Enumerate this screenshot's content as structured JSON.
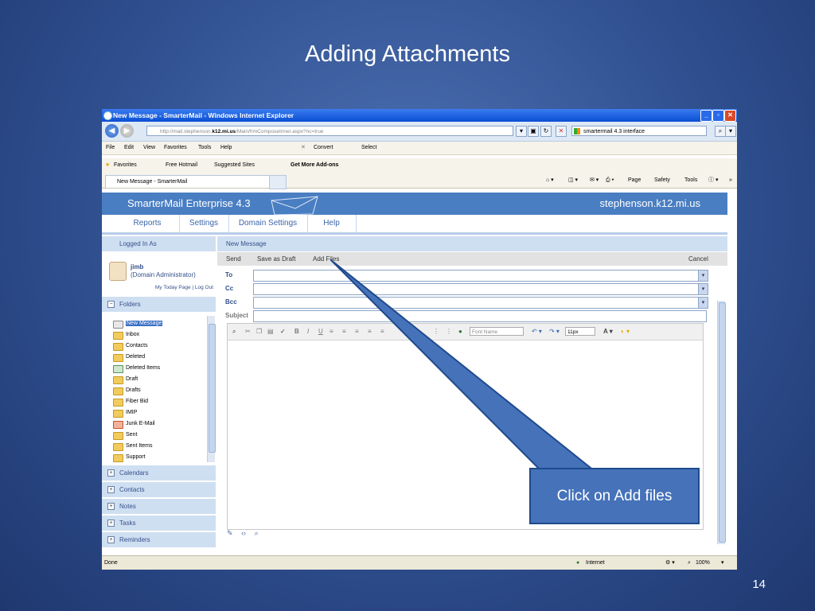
{
  "slide": {
    "title": "Adding Attachments",
    "page_number": "14"
  },
  "window": {
    "title": "New Message - SmarterMail - Windows Internet Explorer"
  },
  "address": {
    "url_prefix": "http://mail.stephenson.",
    "url_bold": "k12.mi.us",
    "url_suffix": "/Main/frmComposeInner.aspx?nc=true",
    "search_text": "smartermail 4.3 interface"
  },
  "menu": {
    "items": [
      "File",
      "Edit",
      "View",
      "Favorites",
      "Tools",
      "Help"
    ],
    "convert": "Convert",
    "select": "Select"
  },
  "favorites": {
    "label": "Favorites",
    "items": [
      "Free Hotmail",
      "Suggested Sites",
      "Get More Add-ons"
    ]
  },
  "tab": {
    "label": "New Message - SmarterMail",
    "cmd": [
      "Page",
      "Safety",
      "Tools"
    ]
  },
  "smartermail": {
    "brand": "SmarterMail Enterprise 4.3",
    "domain": "stephenson.k12.mi.us",
    "nav": [
      "Reports",
      "Settings",
      "Domain Settings",
      "Help"
    ]
  },
  "left": {
    "logged_in_header": "Logged In As",
    "user": "jimb",
    "role": "(Domain Administrator)",
    "links": "My Today Page | Log Out",
    "folders_header": "Folders",
    "folders": [
      "New Message",
      "Inbox",
      "Contacts",
      "Deleted",
      "Deleted Items",
      "Draft",
      "Drafts",
      "Fiber Bid",
      "IMIP",
      "Junk E-Mail",
      "Sent",
      "Sent Items",
      "Support"
    ],
    "sections": [
      "Calendars",
      "Contacts",
      "Notes",
      "Tasks",
      "Reminders"
    ]
  },
  "compose": {
    "header": "New Message",
    "send": "Send",
    "save_draft": "Save as Draft",
    "add_files": "Add Files",
    "cancel": "Cancel",
    "to": "To",
    "cc": "Cc",
    "bcc": "Bcc",
    "subject": "Subject",
    "font_name": "Font Name",
    "font_size": "11px"
  },
  "status": {
    "left": "Done",
    "zone": "Internet",
    "zoom": "100%"
  },
  "callout": {
    "text": "Click on Add files"
  }
}
